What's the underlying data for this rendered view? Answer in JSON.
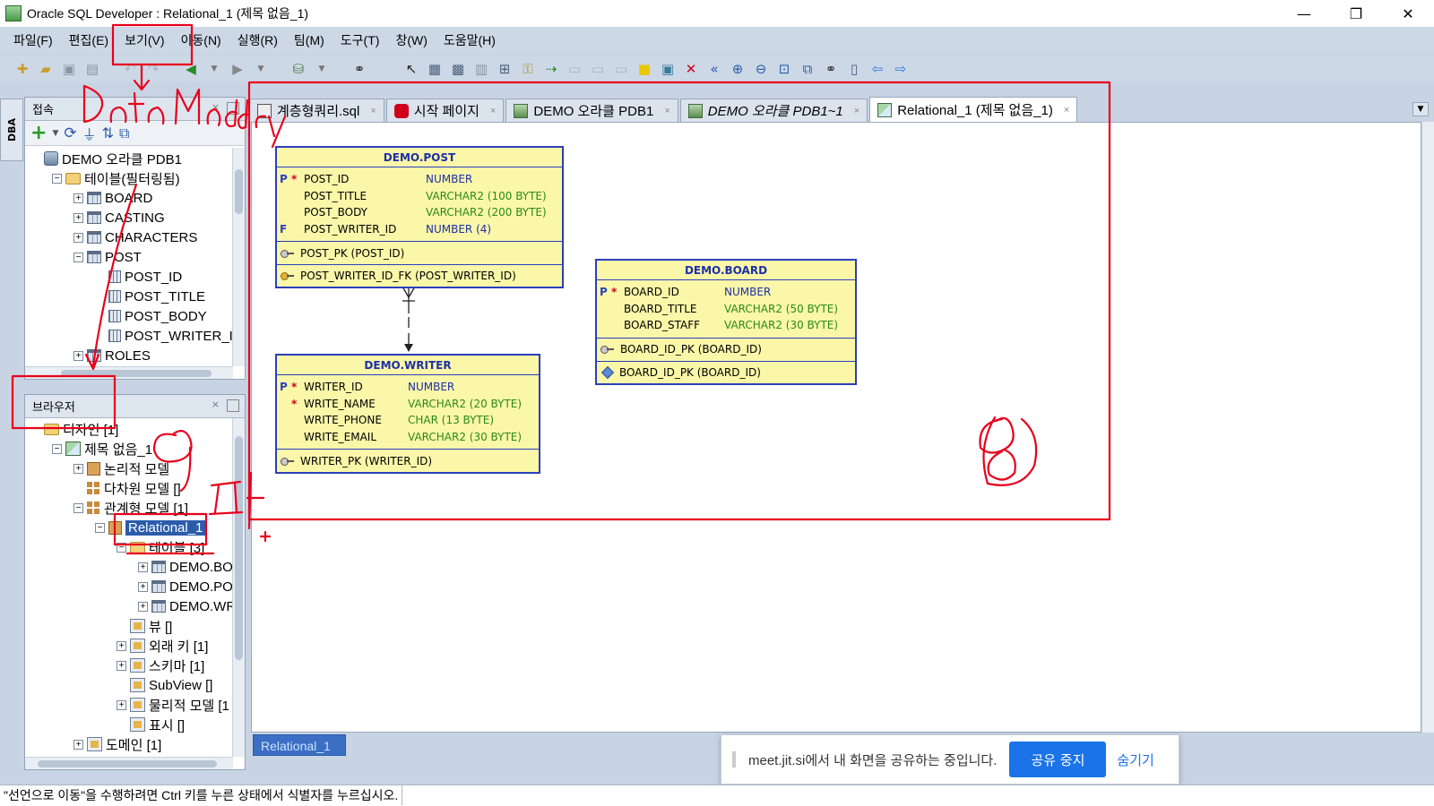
{
  "window": {
    "title": "Oracle SQL Developer : Relational_1 (제목 없음_1)",
    "minimize": "—",
    "maximize": "❐",
    "close": "✕"
  },
  "menu": [
    "파일(F)",
    "편집(E)",
    "보기(V)",
    "이동(N)",
    "실행(R)",
    "팀(M)",
    "도구(T)",
    "창(W)",
    "도움말(H)"
  ],
  "side_strip": {
    "label": "DBA"
  },
  "connections": {
    "title": "접속",
    "close": "×",
    "tree": [
      {
        "label": "DEMO 오라클 PDB1",
        "level": 0,
        "icon": "database-icon",
        "expander": ""
      },
      {
        "label": "테이블(필터링됨)",
        "level": 1,
        "icon": "folder-icon",
        "expander": "−"
      },
      {
        "label": "BOARD",
        "level": 2,
        "icon": "table-icon",
        "expander": "+"
      },
      {
        "label": "CASTING",
        "level": 2,
        "icon": "table-icon",
        "expander": "+"
      },
      {
        "label": "CHARACTERS",
        "level": 2,
        "icon": "table-icon",
        "expander": "+"
      },
      {
        "label": "POST",
        "level": 2,
        "icon": "table-icon",
        "expander": "−"
      },
      {
        "label": "POST_ID",
        "level": 3,
        "icon": "column-icon",
        "expander": ""
      },
      {
        "label": "POST_TITLE",
        "level": 3,
        "icon": "column-icon",
        "expander": ""
      },
      {
        "label": "POST_BODY",
        "level": 3,
        "icon": "column-icon",
        "expander": ""
      },
      {
        "label": "POST_WRITER_ID",
        "level": 3,
        "icon": "column-icon",
        "expander": ""
      },
      {
        "label": "ROLES",
        "level": 2,
        "icon": "table-icon",
        "expander": "+"
      }
    ]
  },
  "browser": {
    "title": "브라우저",
    "close": "×",
    "tree": [
      {
        "label": "디자인 [1]",
        "level": 0,
        "icon": "folder-icon",
        "expander": ""
      },
      {
        "label": "제목 없음_1",
        "level": 1,
        "icon": "design-icon",
        "expander": "−"
      },
      {
        "label": "논리적 모델",
        "level": 2,
        "icon": "logical-model-icon",
        "expander": "+"
      },
      {
        "label": "다차원 모델 []",
        "level": 2,
        "icon": "multidim-model-icon",
        "expander": ""
      },
      {
        "label": "관계형 모델 [1]",
        "level": 2,
        "icon": "relational-models-icon",
        "expander": "−"
      },
      {
        "label": "Relational_1",
        "level": 3,
        "icon": "relational-model-icon",
        "expander": "−",
        "selected": true
      },
      {
        "label": "테이블 [3]",
        "level": 4,
        "icon": "folder-icon",
        "expander": "−"
      },
      {
        "label": "DEMO.BOA",
        "level": 5,
        "icon": "table-icon",
        "expander": "+"
      },
      {
        "label": "DEMO.POS",
        "level": 5,
        "icon": "table-icon",
        "expander": "+"
      },
      {
        "label": "DEMO.WRI",
        "level": 5,
        "icon": "table-icon",
        "expander": "+"
      },
      {
        "label": "뷰 []",
        "level": 4,
        "icon": "view-icon",
        "expander": ""
      },
      {
        "label": "외래 키 [1]",
        "level": 4,
        "icon": "foreign-key-icon",
        "expander": "+"
      },
      {
        "label": "스키마 [1]",
        "level": 4,
        "icon": "schema-icon",
        "expander": "+"
      },
      {
        "label": "SubView []",
        "level": 4,
        "icon": "subview-icon",
        "expander": ""
      },
      {
        "label": "물리적 모델 [1",
        "level": 4,
        "icon": "physical-model-icon",
        "expander": "+"
      },
      {
        "label": "표시 []",
        "level": 4,
        "icon": "display-icon",
        "expander": ""
      },
      {
        "label": "도메인 [1]",
        "level": 2,
        "icon": "domain-icon",
        "expander": "+"
      }
    ]
  },
  "tabs": [
    {
      "label": "계층형쿼리.sql",
      "icon": "sql-file-icon",
      "active": false,
      "italic": false
    },
    {
      "label": "시작 페이지",
      "icon": "start-page-icon",
      "active": false,
      "italic": false
    },
    {
      "label": "DEMO 오라클 PDB1",
      "icon": "sql-connection-icon",
      "active": false,
      "italic": false
    },
    {
      "label": "DEMO 오라클 PDB1~1",
      "icon": "sql-connection-icon",
      "active": false,
      "italic": true
    },
    {
      "label": "Relational_1 (제목 없음_1)",
      "icon": "relational-model-icon",
      "active": true,
      "italic": false
    }
  ],
  "tab_close": "×",
  "entities": [
    {
      "title": "DEMO.POST",
      "columns": [
        {
          "flag": "P",
          "req": "*",
          "name": "POST_ID",
          "type": "NUMBER",
          "type_kind": "num"
        },
        {
          "flag": "",
          "req": "",
          "name": "POST_TITLE",
          "type": "VARCHAR2 (100 BYTE)",
          "type_kind": "txt"
        },
        {
          "flag": "",
          "req": "",
          "name": "POST_BODY",
          "type": "VARCHAR2 (200 BYTE)",
          "type_kind": "txt"
        },
        {
          "flag": "F",
          "req": "",
          "name": "POST_WRITER_ID",
          "type": "NUMBER (4)",
          "type_kind": "num"
        }
      ],
      "keys": [
        {
          "kind": "pk",
          "text": "POST_PK (POST_ID)"
        },
        {
          "kind": "fk",
          "text": "POST_WRITER_ID_FK (POST_WRITER_ID)"
        }
      ]
    },
    {
      "title": "DEMO.WRITER",
      "columns": [
        {
          "flag": "P",
          "req": "*",
          "name": "WRITER_ID",
          "type": "NUMBER",
          "type_kind": "num"
        },
        {
          "flag": "",
          "req": "*",
          "name": "WRITE_NAME",
          "type": "VARCHAR2 (20 BYTE)",
          "type_kind": "txt"
        },
        {
          "flag": "",
          "req": "",
          "name": "WRITE_PHONE",
          "type": "CHAR (13 BYTE)",
          "type_kind": "txt"
        },
        {
          "flag": "",
          "req": "",
          "name": "WRITE_EMAIL",
          "type": "VARCHAR2 (30 BYTE)",
          "type_kind": "txt"
        }
      ],
      "keys": [
        {
          "kind": "pk",
          "text": "WRITER_PK (WRITER_ID)"
        }
      ]
    },
    {
      "title": "DEMO.BOARD",
      "columns": [
        {
          "flag": "P",
          "req": "*",
          "name": "BOARD_ID",
          "type": "NUMBER",
          "type_kind": "num"
        },
        {
          "flag": "",
          "req": "",
          "name": "BOARD_TITLE",
          "type": "VARCHAR2 (50 BYTE)",
          "type_kind": "txt"
        },
        {
          "flag": "",
          "req": "",
          "name": "BOARD_STAFF",
          "type": "VARCHAR2 (30 BYTE)",
          "type_kind": "txt"
        }
      ],
      "keys": [
        {
          "kind": "pk",
          "text": "BOARD_ID_PK (BOARD_ID)"
        },
        {
          "kind": "uk",
          "text": "BOARD_ID_PK (BOARD_ID)"
        }
      ]
    }
  ],
  "bottom_tab": {
    "label": "Relational_1"
  },
  "notification": {
    "text": "meet.jit.si에서 내 화면을 공유하는 중입니다.",
    "stop_label": "공유 중지",
    "hide_label": "숨기기"
  },
  "status": {
    "text": "\"선언으로 이동\"을 수행하려면 Ctrl 키를 누른 상태에서 식별자를 누르십시오."
  },
  "colors": {
    "annotation": "#e8001c",
    "entity_fill": "#fbf7a8",
    "entity_border": "#2b3fbe",
    "accent": "#1a73e8"
  }
}
